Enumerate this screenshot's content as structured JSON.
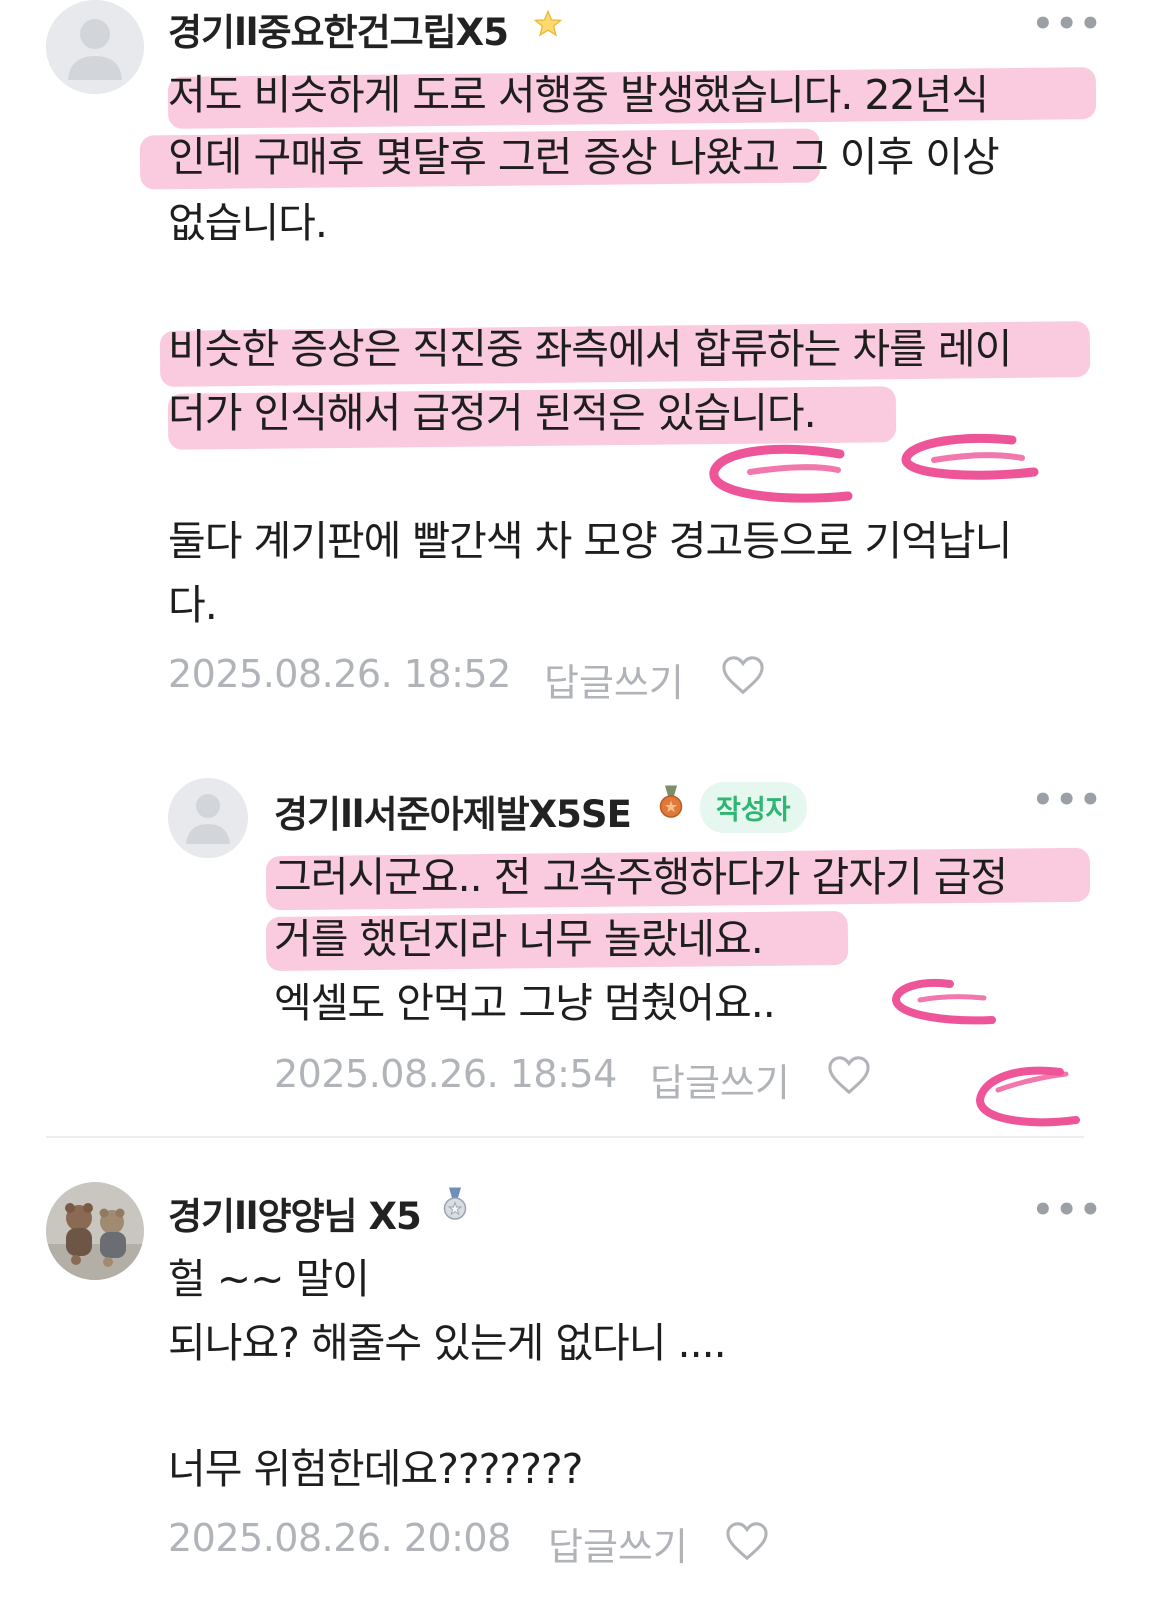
{
  "accent": {
    "highlight": "#f282b2",
    "author_tag_bg": "#e5f7ee",
    "author_tag_fg": "#2fb673",
    "meta": "#b0b3b8"
  },
  "comments": [
    {
      "nickname": "경기ll중요한건그립X5",
      "badge_icon": "star-icon",
      "more": "•••",
      "lines": [
        "저도 비슷하게 도로 서행중 발생했습니다. 22년식",
        "인데 구매후 몇달후 그런 증상 나왔고 그 이후 이상",
        "없습니다.",
        "",
        "비슷한 증상은 직진중 좌측에서 합류하는 차를 레이",
        "더가 인식해서 급정거 된적은 있습니다.",
        "",
        "둘다 계기판에 빨간색 차 모양 경고등으로 기억납니",
        "다."
      ],
      "timestamp": "2025.08.26. 18:52",
      "reply_label": "답글쓰기"
    },
    {
      "nickname": "경기ll서준아제발X5SE",
      "badge_icon": "bronze-medal-icon",
      "author_tag": "작성자",
      "more": "•••",
      "lines": [
        "그러시군요.. 전 고속주행하다가 갑자기 급정",
        "거를 했던지라 너무 놀랐네요.",
        "엑셀도 안먹고 그냥 멈췄어요.."
      ],
      "timestamp": "2025.08.26. 18:54",
      "reply_label": "답글쓰기"
    },
    {
      "nickname": "경기ll양양님 X5",
      "badge_icon": "silver-medal-icon",
      "more": "•••",
      "lines": [
        "헐 ~~ 말이",
        "되나요? 해줄수 있는게 없다니 ....",
        "",
        "너무 위험한데요???????"
      ],
      "timestamp": "2025.08.26. 20:08",
      "reply_label": "답글쓰기"
    }
  ]
}
